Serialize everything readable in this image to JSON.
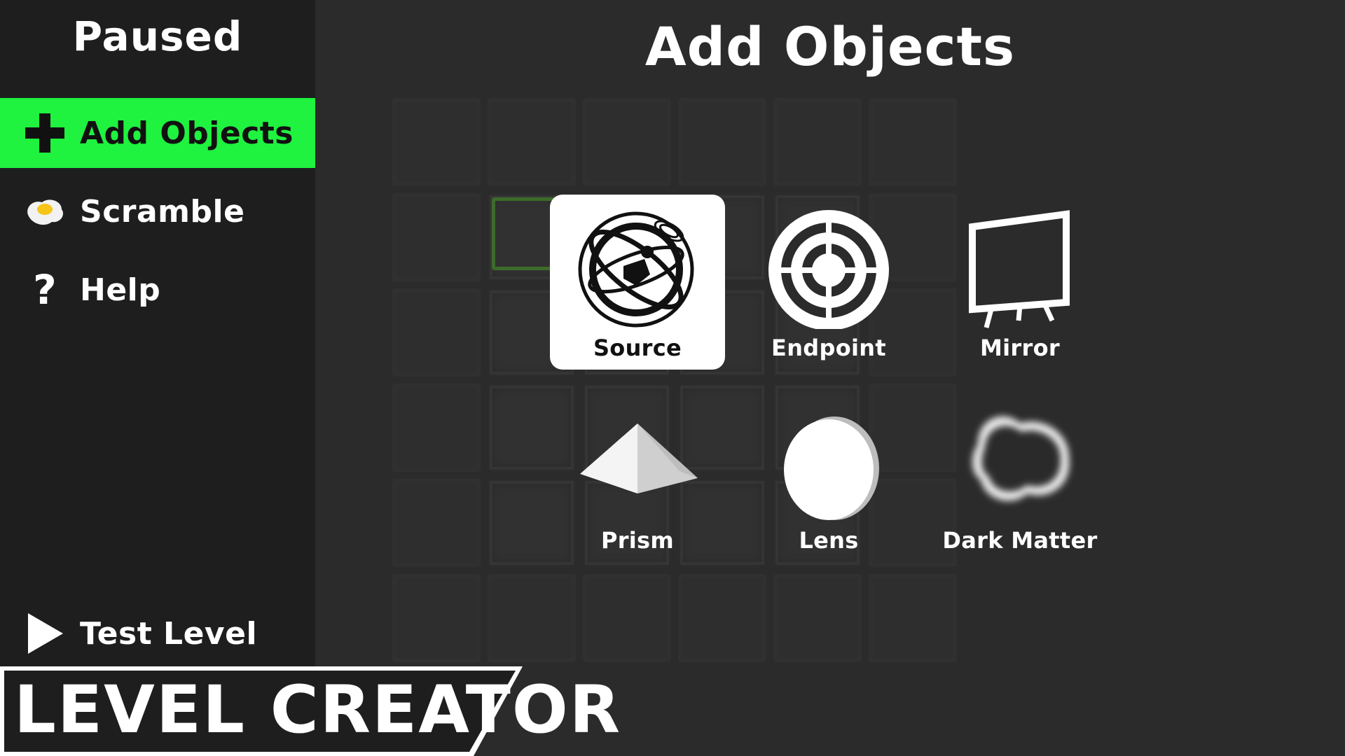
{
  "sidebar": {
    "title": "Paused",
    "items": [
      {
        "label": "Add Objects",
        "icon": "plus-icon",
        "active": true
      },
      {
        "label": "Scramble",
        "icon": "fried-egg-icon",
        "active": false
      },
      {
        "label": "Help",
        "icon": "question-mark-icon",
        "glyph": "?",
        "active": false
      }
    ],
    "test_level": {
      "label": "Test Level",
      "icon": "play-icon"
    }
  },
  "main": {
    "title": "Add Objects",
    "objects": [
      {
        "label": "Source",
        "icon": "source-icon",
        "selected": true
      },
      {
        "label": "Endpoint",
        "icon": "target-icon",
        "selected": false
      },
      {
        "label": "Mirror",
        "icon": "mirror-icon",
        "selected": false
      },
      {
        "label": "Prism",
        "icon": "prism-icon",
        "selected": false
      },
      {
        "label": "Lens",
        "icon": "lens-icon",
        "selected": false
      },
      {
        "label": "Dark Matter",
        "icon": "dark-matter-icon",
        "selected": false
      }
    ]
  },
  "banner": {
    "label": "LEVEL CREATOR"
  },
  "colors": {
    "accent": "#1ff23f",
    "sidebar": "#1e1e1e",
    "background": "#2b2b2b"
  }
}
